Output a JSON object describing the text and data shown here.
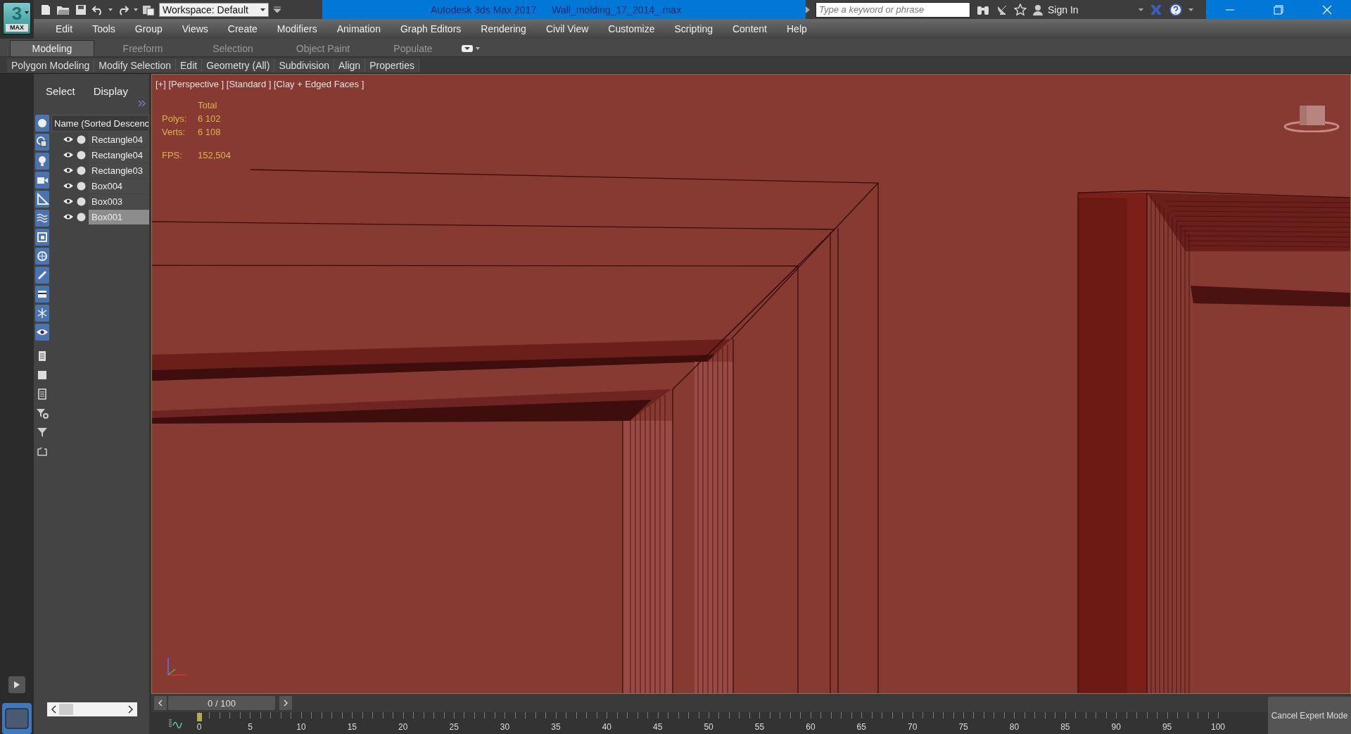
{
  "logo": {
    "main": "3",
    "sub": "MAX"
  },
  "title_bar": {
    "workspace": "Workspace: Default",
    "app_title": "Autodesk 3ds Max 2017",
    "file_name": "Wall_molding_17_2014_.max",
    "search": {
      "placeholder": "Type a keyword or phrase"
    },
    "sign_in": "Sign In"
  },
  "menu": [
    "Edit",
    "Tools",
    "Group",
    "Views",
    "Create",
    "Modifiers",
    "Animation",
    "Graph Editors",
    "Rendering",
    "Civil View",
    "Customize",
    "Scripting",
    "Content",
    "Help"
  ],
  "ribbon_tabs": [
    {
      "label": "Modeling",
      "selected": true
    },
    {
      "label": "Freeform",
      "selected": false
    },
    {
      "label": "Selection",
      "selected": false
    },
    {
      "label": "Object Paint",
      "selected": false
    },
    {
      "label": "Populate",
      "selected": false
    }
  ],
  "ribbon_panels": [
    "Polygon Modeling",
    "Modify Selection",
    "Edit",
    "Geometry (All)",
    "Subdivision",
    "Align",
    "Properties"
  ],
  "scene_explorer": {
    "tabs": [
      "Select",
      "Display"
    ],
    "column": "Name (Sorted Descenc",
    "items": [
      {
        "name": "Rectangle04",
        "selected": false
      },
      {
        "name": "Rectangle04",
        "selected": false
      },
      {
        "name": "Rectangle03",
        "selected": false
      },
      {
        "name": "Box004",
        "selected": false
      },
      {
        "name": "Box003",
        "selected": false
      },
      {
        "name": "Box001",
        "selected": true
      }
    ]
  },
  "viewport": {
    "label": "[+] [Perspective ] [Standard ] [Clay + Edged Faces ]",
    "stats": {
      "heading": "Total",
      "rows": [
        {
          "label": "Polys:",
          "value": "6 102"
        },
        {
          "label": "Verts:",
          "value": "6 108"
        }
      ],
      "fps_label": "FPS:",
      "fps": "152,504"
    }
  },
  "time_slider": {
    "reading": "0 / 100",
    "level": 0
  },
  "timeline": {
    "ticks": [
      "0",
      "5",
      "10",
      "15",
      "20",
      "25",
      "30",
      "35",
      "40",
      "45",
      "50",
      "55",
      "60",
      "65",
      "70",
      "75",
      "80",
      "85",
      "90",
      "95",
      "100"
    ]
  },
  "cancel_button": "Cancel Expert Mode"
}
